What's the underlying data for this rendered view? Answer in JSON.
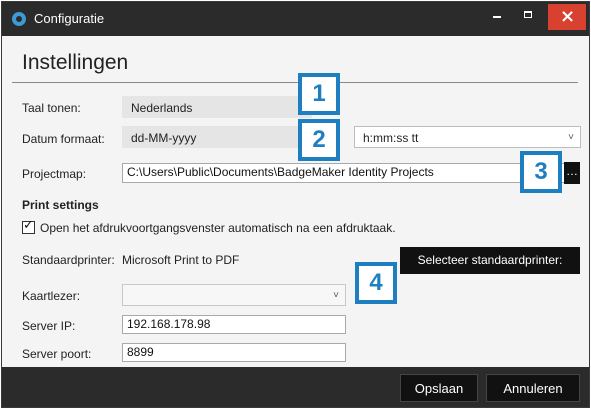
{
  "window": {
    "title": "Configuratie"
  },
  "page": {
    "heading": "Instellingen"
  },
  "settings": {
    "taal_label": "Taal tonen:",
    "taal_value": "Nederlands",
    "datum_label": "Datum formaat:",
    "date_value": "dd-MM-yyyy",
    "time_value": "h:mm:ss tt",
    "project_label": "Projectmap:",
    "project_value": "C:\\Users\\Public\\Documents\\BadgeMaker Identity Projects"
  },
  "print": {
    "section_title": "Print settings",
    "checkbox_label": "Open het afdrukvoortgangsvenster automatisch na een afdruktaak.",
    "checkbox_checked": true,
    "standard_label": "Standaardprinter:",
    "standard_value": "Microsoft Print to PDF",
    "select_button": "Selecteer standaardprinter:",
    "cardreader_label": "Kaartlezer:",
    "cardreader_value": "",
    "server_ip_label": "Server IP:",
    "server_ip_value": "192.168.178.98",
    "server_port_label": "Server poort:",
    "server_port_value": "8899"
  },
  "callouts": [
    "1",
    "2",
    "3",
    "4"
  ],
  "footer": {
    "save_label": "Opslaan",
    "cancel_label": "Annuleren"
  },
  "colors": {
    "accent": "#1e7fc0",
    "titlebar": "#2b2b2b",
    "close": "#d8412f"
  }
}
